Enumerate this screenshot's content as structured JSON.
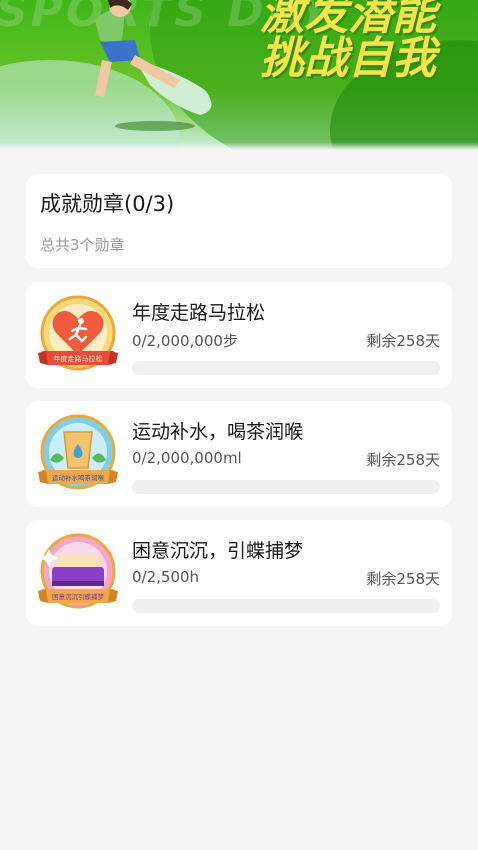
{
  "banner": {
    "bg_text": "SPORTS DAY",
    "title_line1": "激发潜能",
    "title_line2": "挑战自我"
  },
  "summary": {
    "title": "成就勋章(0/3)",
    "subtitle": "总共3个勋章"
  },
  "colors": {
    "brand_green": "#3fb619",
    "title_yellow": "#f4e34a",
    "progress_track": "#f0f0f0"
  },
  "achievements": [
    {
      "name": "年度走路马拉松",
      "progress_text": "0/2,000,000步",
      "remaining": "剩余258天",
      "progress": 0,
      "badge_label": "年度走路马拉松",
      "badge_icon": "running-person-icon"
    },
    {
      "name": "运动补水，喝茶润喉",
      "progress_text": "0/2,000,000ml",
      "remaining": "剩余258天",
      "progress": 0,
      "badge_label": "运动补水喝茶润喉",
      "badge_icon": "water-cup-icon"
    },
    {
      "name": "困意沉沉，引蝶捕梦",
      "progress_text": "0/2,500h",
      "remaining": "剩余258天",
      "progress": 0,
      "badge_label": "困意沉沉引蝶捕梦",
      "badge_icon": "bed-icon"
    }
  ]
}
